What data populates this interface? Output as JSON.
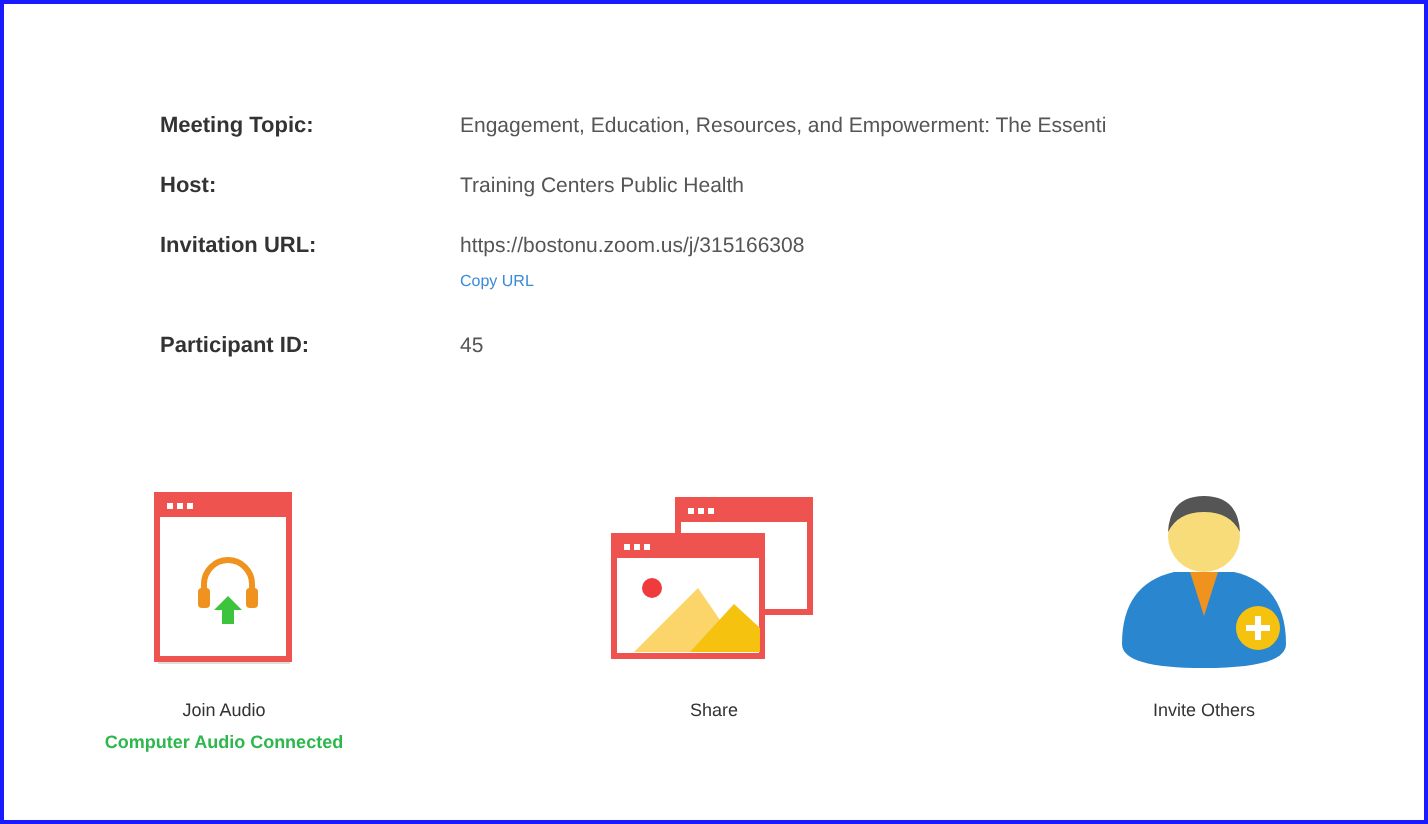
{
  "details": [
    {
      "label": "Meeting Topic:",
      "value": "Engagement, Education, Resources, and Empowerment: The Essenti"
    },
    {
      "label": "Host:",
      "value": "Training Centers Public Health"
    },
    {
      "label": "Invitation URL:",
      "value": "https://bostonu.zoom.us/j/315166308",
      "link": "Copy URL"
    },
    {
      "label": "Participant ID:",
      "value": "45"
    }
  ],
  "actions": [
    {
      "kind": "audio",
      "label": "Join Audio",
      "status": "Computer Audio Connected"
    },
    {
      "kind": "share",
      "label": "Share"
    },
    {
      "kind": "invite",
      "label": "Invite Others"
    }
  ]
}
